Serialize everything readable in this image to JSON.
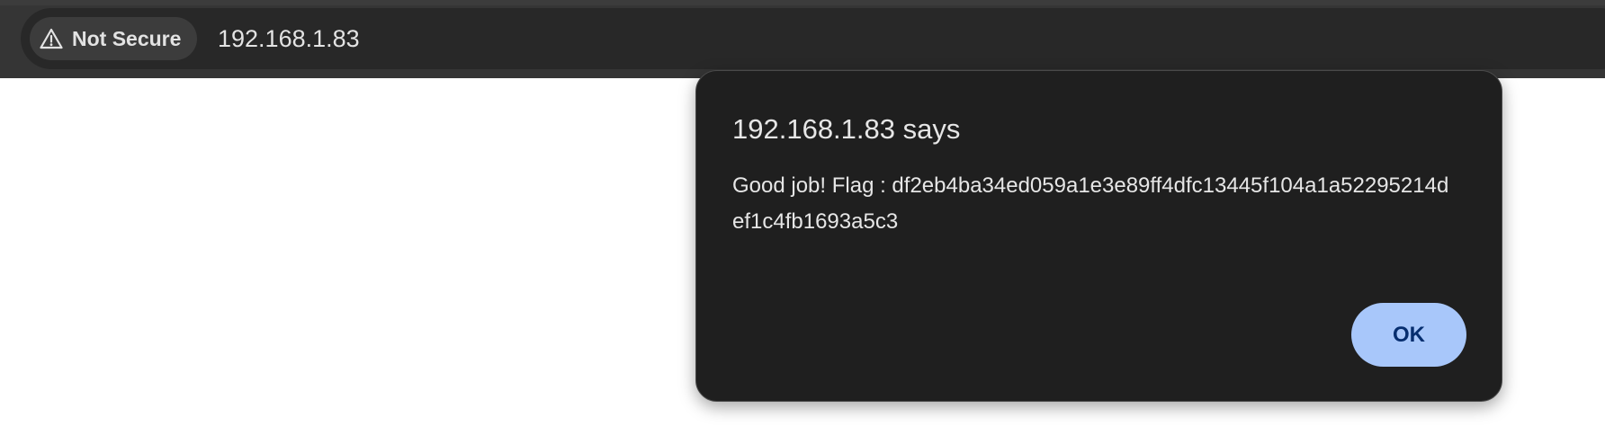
{
  "browser": {
    "security_chip": {
      "icon": "warning-triangle-icon",
      "label": "Not Secure"
    },
    "address": "192.168.1.83"
  },
  "alert_dialog": {
    "title": "192.168.1.83 says",
    "message": "Good job! Flag : df2eb4ba34ed059a1e3e89ff4dfc13445f104a1a52295214def1c4fb1693a5c3",
    "ok_label": "OK"
  },
  "colors": {
    "toolbar": "#353535",
    "omnibox": "#282828",
    "dialog_background": "#1f1f1f",
    "button_background": "#a8c7fa",
    "button_text": "#062e6f"
  }
}
